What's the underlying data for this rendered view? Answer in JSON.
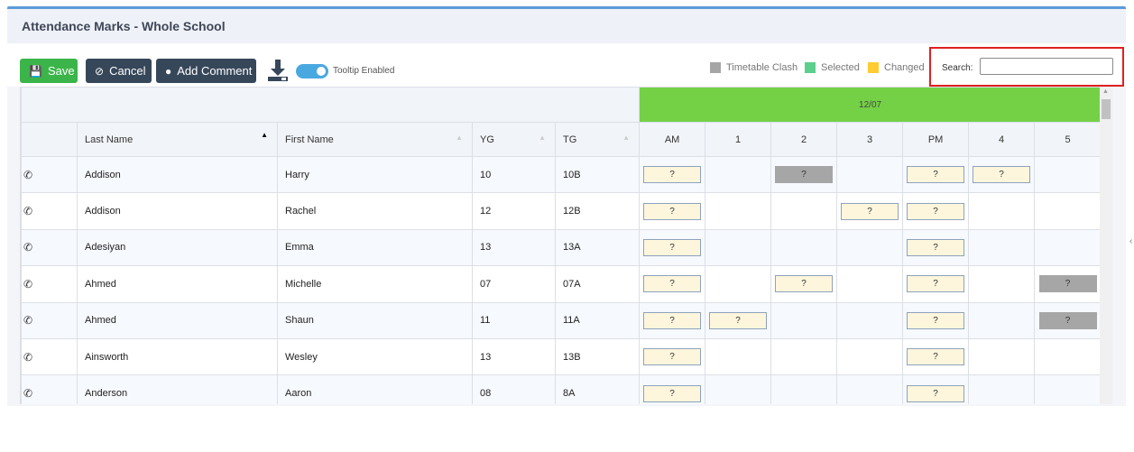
{
  "page": {
    "title": "Attendance Marks - Whole School"
  },
  "toolbar": {
    "save_label": "Save",
    "cancel_label": "Cancel",
    "comment_label": "Add Comment",
    "toggle_label": "Tooltip Enabled",
    "toggle_on": true
  },
  "legend": [
    {
      "label": "Timetable Clash",
      "color": "#a6a6a6"
    },
    {
      "label": "Selected",
      "color": "#5ccf8c"
    },
    {
      "label": "Changed",
      "color": "#ffcc33"
    }
  ],
  "search": {
    "label": "Search:",
    "value": ""
  },
  "grid": {
    "date": "12/07",
    "columns": [
      "Last Name",
      "First Name",
      "YG",
      "TG"
    ],
    "sessions": [
      "AM",
      "1",
      "2",
      "3",
      "PM",
      "4",
      "5"
    ],
    "rows": [
      {
        "last": "Addison",
        "first": "Harry",
        "yg": "10",
        "tg": "10B",
        "marks": [
          "?",
          "",
          "?",
          "",
          "?",
          "?",
          ""
        ],
        "clash": [
          false,
          false,
          true,
          false,
          false,
          false,
          false
        ]
      },
      {
        "last": "Addison",
        "first": "Rachel",
        "yg": "12",
        "tg": "12B",
        "marks": [
          "?",
          "",
          "",
          "?",
          "?",
          "",
          ""
        ],
        "clash": [
          false,
          false,
          false,
          false,
          false,
          false,
          false
        ]
      },
      {
        "last": "Adesiyan",
        "first": "Emma",
        "yg": "13",
        "tg": "13A",
        "marks": [
          "?",
          "",
          "",
          "",
          "?",
          "",
          ""
        ],
        "clash": [
          false,
          false,
          false,
          false,
          false,
          false,
          false
        ]
      },
      {
        "last": "Ahmed",
        "first": "Michelle",
        "yg": "07",
        "tg": "07A",
        "marks": [
          "?",
          "",
          "?",
          "",
          "?",
          "",
          "?"
        ],
        "clash": [
          false,
          false,
          false,
          false,
          false,
          false,
          true
        ]
      },
      {
        "last": "Ahmed",
        "first": "Shaun",
        "yg": "11",
        "tg": "11A",
        "marks": [
          "?",
          "?",
          "",
          "",
          "?",
          "",
          "?"
        ],
        "clash": [
          false,
          false,
          false,
          false,
          false,
          false,
          true
        ]
      },
      {
        "last": "Ainsworth",
        "first": "Wesley",
        "yg": "13",
        "tg": "13B",
        "marks": [
          "?",
          "",
          "",
          "",
          "?",
          "",
          ""
        ],
        "clash": [
          false,
          false,
          false,
          false,
          false,
          false,
          false
        ]
      },
      {
        "last": "Anderson",
        "first": "Aaron",
        "yg": "08",
        "tg": "8A",
        "marks": [
          "?",
          "",
          "",
          "",
          "?",
          "",
          ""
        ],
        "clash": [
          false,
          false,
          false,
          false,
          false,
          false,
          false
        ]
      }
    ]
  }
}
